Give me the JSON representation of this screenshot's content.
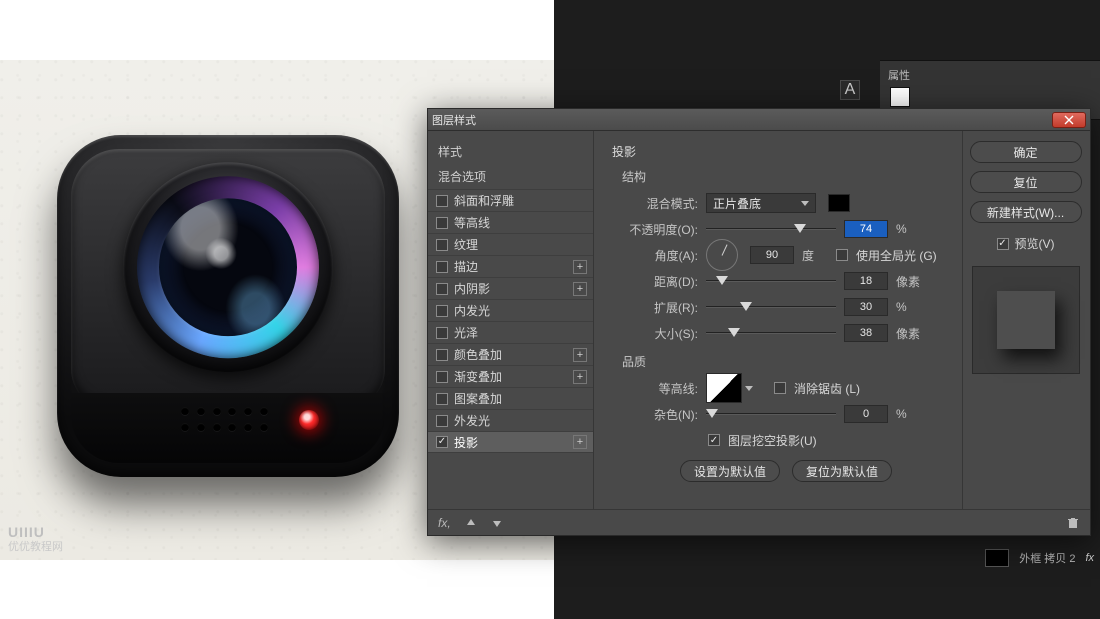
{
  "domain": "Computer-Use",
  "ps_ui": {
    "char_panel_glyph": "A",
    "swatches_label": "属性",
    "layer_footer": {
      "name": "外框 拷贝 2",
      "fx": "fx"
    }
  },
  "watermark": {
    "brand": "UIIIU",
    "sub": "优优教程网"
  },
  "dialog": {
    "title": "图层样式",
    "left": {
      "styles": "样式",
      "blending": "混合选项",
      "items": [
        {
          "key": "bevel",
          "label": "斜面和浮雕",
          "checked": false,
          "plus": false,
          "indent": false
        },
        {
          "key": "contour",
          "label": "等高线",
          "checked": false,
          "plus": false,
          "indent": true
        },
        {
          "key": "texture",
          "label": "纹理",
          "checked": false,
          "plus": false,
          "indent": true
        },
        {
          "key": "stroke",
          "label": "描边",
          "checked": false,
          "plus": true,
          "indent": false
        },
        {
          "key": "innerShadow",
          "label": "内阴影",
          "checked": false,
          "plus": true,
          "indent": false
        },
        {
          "key": "innerGlow",
          "label": "内发光",
          "checked": false,
          "plus": false,
          "indent": false
        },
        {
          "key": "satin",
          "label": "光泽",
          "checked": false,
          "plus": false,
          "indent": false
        },
        {
          "key": "colorOverlay",
          "label": "颜色叠加",
          "checked": false,
          "plus": true,
          "indent": false
        },
        {
          "key": "gradientOverlay",
          "label": "渐变叠加",
          "checked": false,
          "plus": true,
          "indent": false
        },
        {
          "key": "patternOverlay",
          "label": "图案叠加",
          "checked": false,
          "plus": false,
          "indent": false
        },
        {
          "key": "outerGlow",
          "label": "外发光",
          "checked": false,
          "plus": false,
          "indent": false
        },
        {
          "key": "dropShadow",
          "label": "投影",
          "checked": true,
          "plus": true,
          "indent": false,
          "selected": true
        }
      ]
    },
    "mid": {
      "section": "投影",
      "structure": "结构",
      "blend_label": "混合模式:",
      "blend_value": "正片叠底",
      "opacity_label": "不透明度(O):",
      "opacity_value": "74",
      "opacity_unit": "%",
      "angle_label": "角度(A):",
      "angle_value": "90",
      "angle_unit": "度",
      "global_light_label": "使用全局光 (G)",
      "global_light_checked": false,
      "distance_label": "距离(D):",
      "distance_value": "18",
      "spread_label": "扩展(R):",
      "spread_value": "30",
      "spread_unit": "%",
      "size_label": "大小(S):",
      "size_value": "38",
      "px_unit": "像素",
      "quality": "品质",
      "contour_label": "等高线:",
      "antialias_label": "消除锯齿 (L)",
      "antialias_checked": false,
      "noise_label": "杂色(N):",
      "noise_value": "0",
      "noise_unit": "%",
      "knockout_label": "图层挖空投影(U)",
      "knockout_checked": true,
      "reset_default": "设置为默认值",
      "make_default": "复位为默认值"
    },
    "right": {
      "ok": "确定",
      "cancel": "复位",
      "new_style": "新建样式(W)...",
      "preview_label": "预览(V)",
      "preview_checked": true
    },
    "footer": {
      "fx": "fx,"
    }
  }
}
